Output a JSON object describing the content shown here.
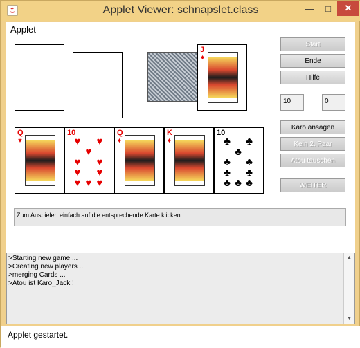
{
  "window": {
    "title": "Applet Viewer: schnapslet.class"
  },
  "menubar": {
    "applet": "Applet"
  },
  "buttons": {
    "start": "Start",
    "ende": "Ende",
    "hilfe": "Hilfe",
    "karo_ansagen": "Karo ansagen",
    "kein_paar": "Kein 2. Paar",
    "atou_tauschen": "Atou tauschen",
    "weiter": "WEITER"
  },
  "scores": {
    "left": "10",
    "right": "0"
  },
  "atou_card": {
    "rank": "J",
    "suit": "♦"
  },
  "hand": [
    {
      "rank": "Q",
      "suit": "♥"
    },
    {
      "rank": "10",
      "suit": "♥"
    },
    {
      "rank": "Q",
      "suit": "♦"
    },
    {
      "rank": "K",
      "suit": "♦"
    },
    {
      "rank": "10",
      "suit": "♣"
    }
  ],
  "status_message": "Zum Auspielen einfach auf die entsprechende Karte klicken",
  "console": ">Starting new game ...\n>Creating new players ...\n>merging Cards ...\n>Atou ist Karo_Jack !",
  "applet_status": "Applet gestartet."
}
